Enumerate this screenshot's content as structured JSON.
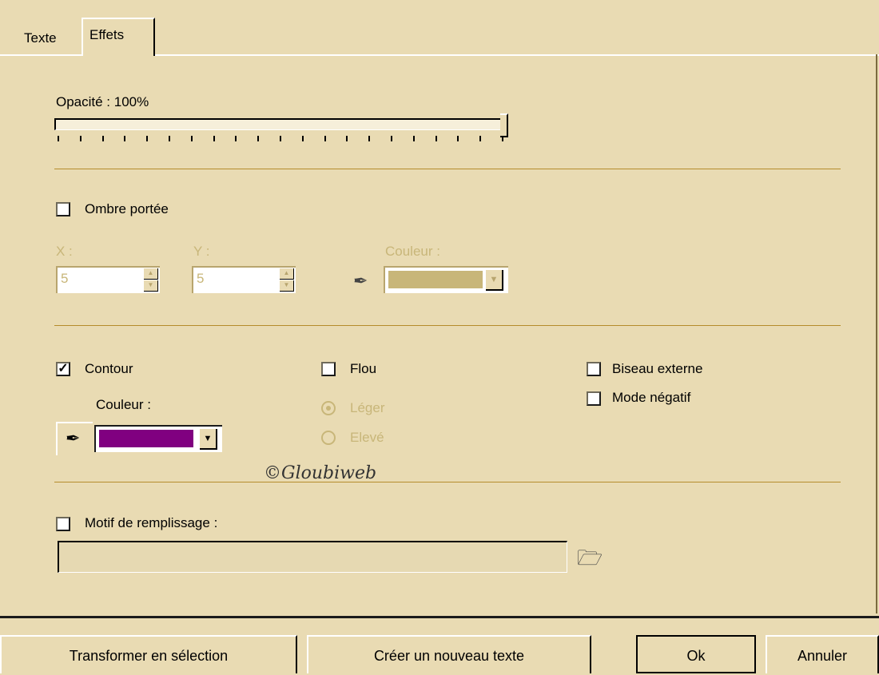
{
  "tabs": [
    {
      "label": "Texte",
      "active": false
    },
    {
      "label": "Effets",
      "active": true
    }
  ],
  "opacity": {
    "label": "Opacité : 100%",
    "value_percent": 100
  },
  "drop_shadow": {
    "label": "Ombre portée",
    "checked": false,
    "x_label": "X :",
    "x_value": "5",
    "y_label": "Y :",
    "y_value": "5",
    "color_label": "Couleur :",
    "color": "#c8b679"
  },
  "contour": {
    "label": "Contour",
    "checked": true,
    "color_label": "Couleur :",
    "color": "#800080"
  },
  "blur": {
    "label": "Flou",
    "checked": false,
    "options": [
      "Léger",
      "Elevé"
    ],
    "selected": "Léger"
  },
  "bevel": {
    "label": "Biseau externe",
    "checked": false
  },
  "negative": {
    "label": "Mode négatif",
    "checked": false
  },
  "watermark": "©Gloubiweb",
  "fill_pattern": {
    "label": "Motif de remplissage :",
    "checked": false,
    "path": ""
  },
  "buttons": {
    "transform": "Transformer en sélection",
    "new_text": "Créer un nouveau texte",
    "ok": "Ok",
    "cancel": "Annuler"
  },
  "icons": {
    "eyedropper": "eyedropper-icon",
    "folder": "folder-open-icon"
  },
  "colors": {
    "background": "#e9dbb3",
    "separator": "#b58c2c",
    "disabled_text": "#c8b679"
  }
}
